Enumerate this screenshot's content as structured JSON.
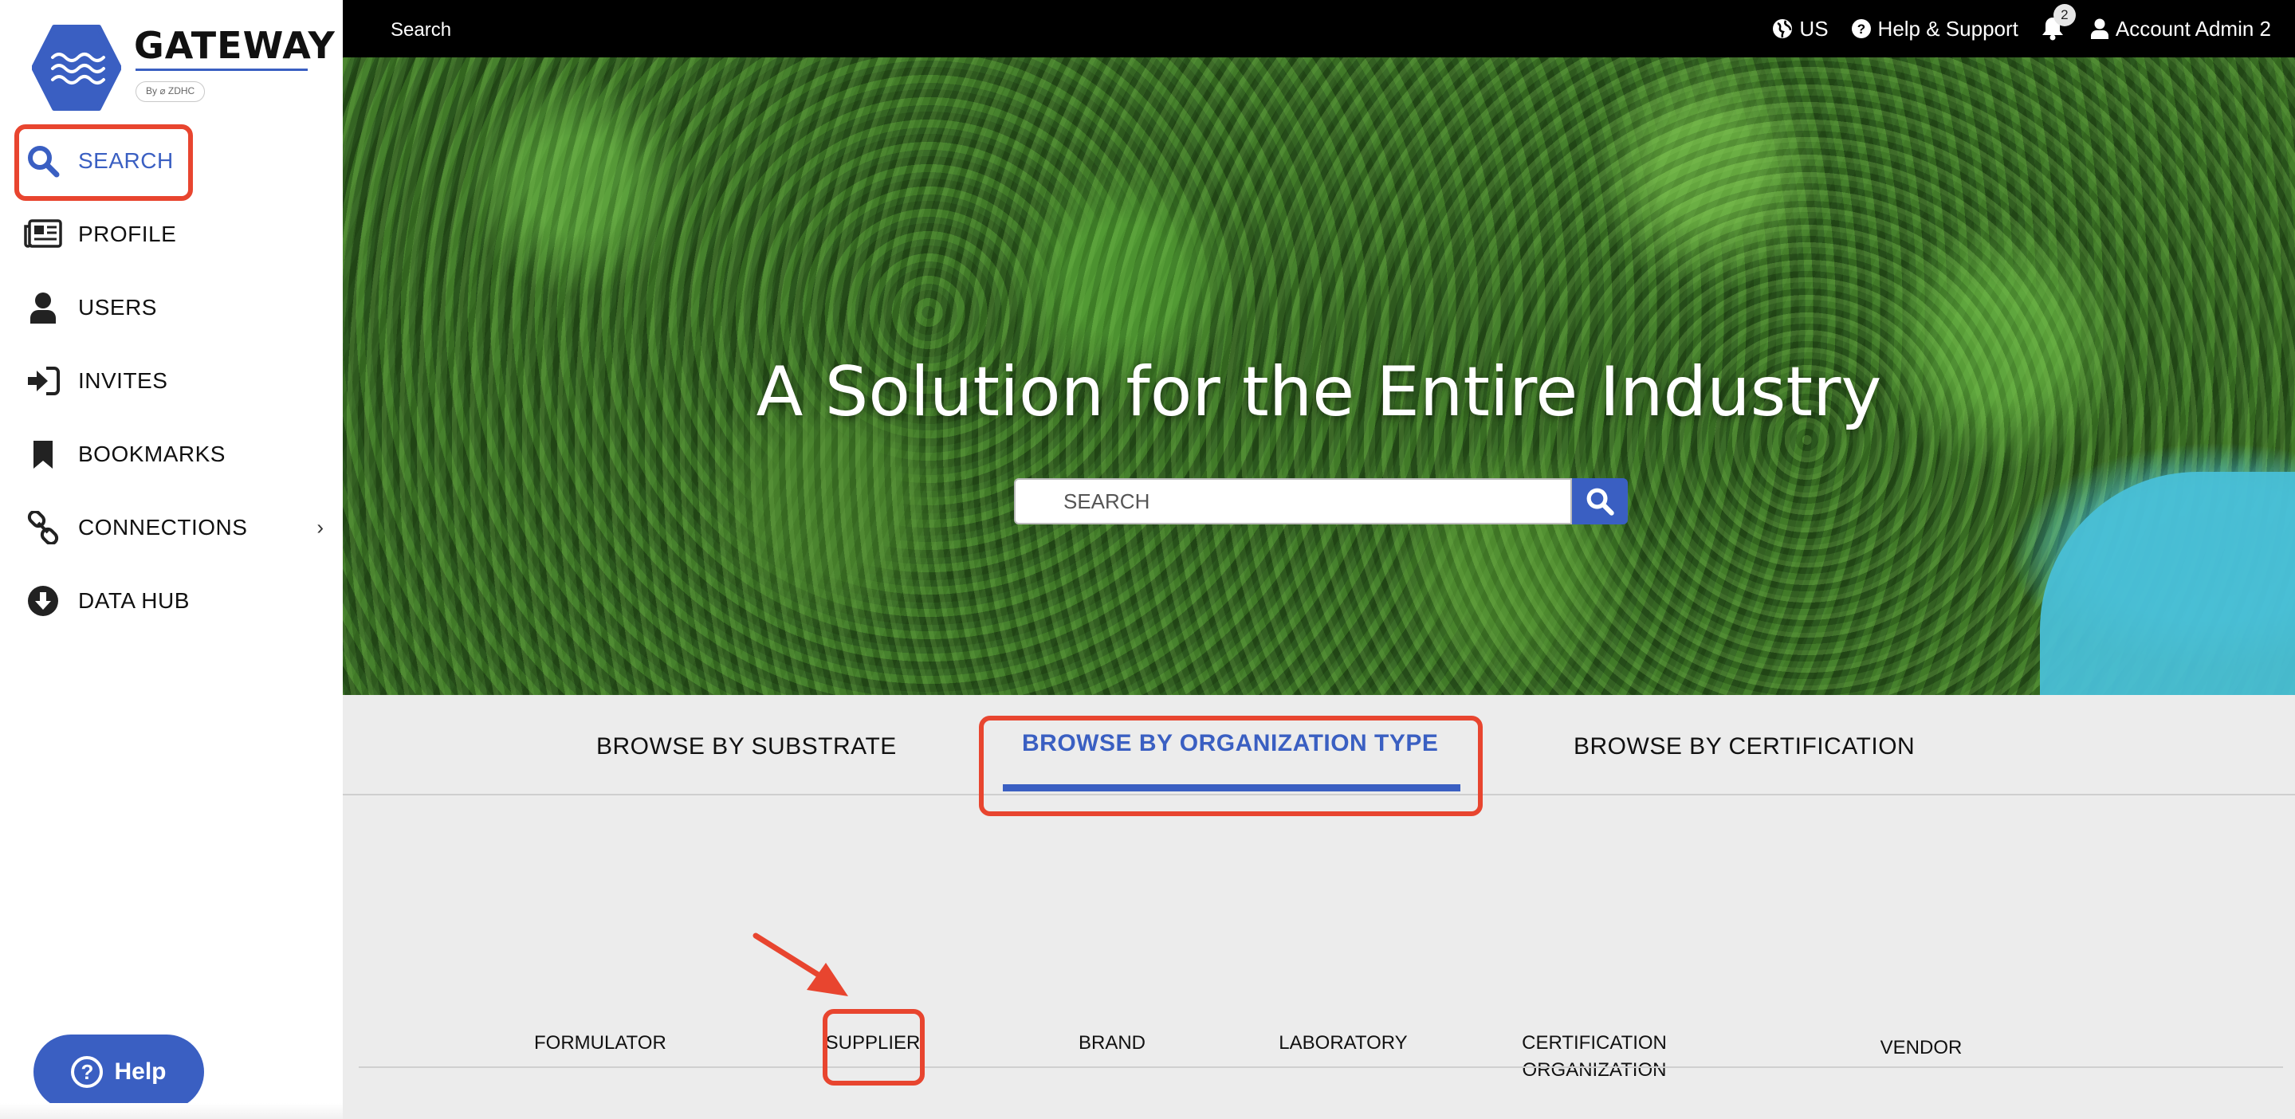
{
  "brand": {
    "name": "GATEWAY",
    "byline": "By ⌀ ZDHC",
    "accent_color": "#3a5fc2",
    "highlight_color": "#e8452f"
  },
  "sidebar": {
    "items": [
      {
        "label": "SEARCH",
        "icon": "search-icon",
        "active": true
      },
      {
        "label": "PROFILE",
        "icon": "newspaper-icon",
        "active": false
      },
      {
        "label": "USERS",
        "icon": "user-icon",
        "active": false
      },
      {
        "label": "INVITES",
        "icon": "sign-in-icon",
        "active": false
      },
      {
        "label": "BOOKMARKS",
        "icon": "bookmark-icon",
        "active": false
      },
      {
        "label": "CONNECTIONS",
        "icon": "link-icon",
        "active": false,
        "expandable": true
      },
      {
        "label": "DATA HUB",
        "icon": "download-circle-icon",
        "active": false
      }
    ],
    "help_label": "Help"
  },
  "topbar": {
    "title": "Search",
    "region": "US",
    "help_support": "Help & Support",
    "notification_count": "2",
    "account": "Account Admin 2"
  },
  "hero": {
    "title": "A Solution for the Entire Industry",
    "search_placeholder": "SEARCH"
  },
  "browse": {
    "tabs": [
      {
        "label": "BROWSE BY SUBSTRATE",
        "active": false
      },
      {
        "label": "BROWSE BY ORGANIZATION TYPE",
        "active": true
      },
      {
        "label": "BROWSE BY CERTIFICATION",
        "active": false
      }
    ],
    "org_types": [
      {
        "label": "FORMULATOR"
      },
      {
        "label": "SUPPLIER"
      },
      {
        "label": "BRAND"
      },
      {
        "label": "LABORATORY"
      },
      {
        "label": "CERTIFICATION",
        "label2": "ORGANIZATION"
      },
      {
        "label": "VENDOR"
      }
    ]
  }
}
